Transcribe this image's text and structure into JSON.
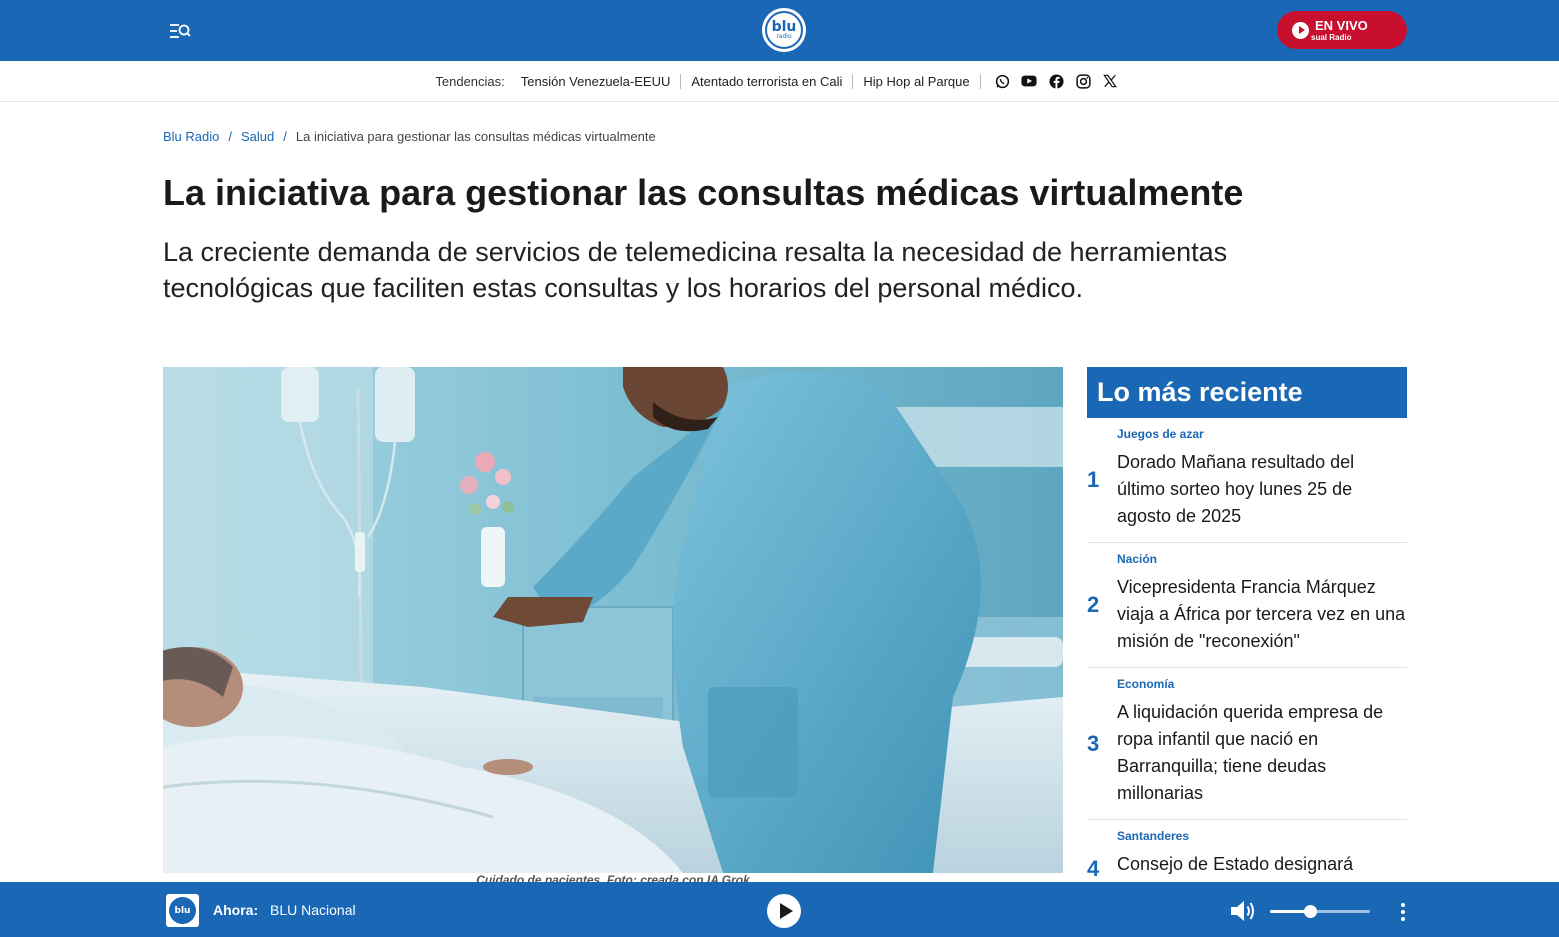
{
  "header": {
    "logo_text": "blu",
    "logo_sub": "radio",
    "live_label": "EN VIVO",
    "live_sub": "sual Radio"
  },
  "trends": {
    "label": "Tendencias:",
    "items": [
      "Tensión Venezuela-EEUU",
      "Atentado terrorista en Cali",
      "Hip Hop al Parque"
    ],
    "social_icons": [
      "whatsapp-icon",
      "youtube-icon",
      "facebook-icon",
      "instagram-icon",
      "x-icon"
    ]
  },
  "breadcrumb": {
    "items": [
      "Blu Radio",
      "Salud"
    ],
    "separator": "/",
    "current": "La iniciativa para gestionar las consultas médicas virtualmente"
  },
  "article": {
    "title": "La iniciativa para gestionar las consultas médicas virtualmente",
    "subtitle": "La creciente demanda de servicios de telemedicina resalta la necesidad de herramientas tecnológicas que faciliten estas consultas y los horarios del personal médico.",
    "caption": "Cuidado de pacientes. Foto: creada con IA Grok"
  },
  "sidebar": {
    "title": "Lo más reciente",
    "items": [
      {
        "num": "1",
        "category": "Juegos de azar",
        "headline": "Dorado Mañana resultado del último sorteo hoy lunes 25 de agosto de 2025"
      },
      {
        "num": "2",
        "category": "Nación",
        "headline": "Vicepresidenta Francia Márquez viaja a África por tercera vez en una misión de \"reconexión\""
      },
      {
        "num": "3",
        "category": "Economía",
        "headline": "A liquidación querida empresa de ropa infantil que nació en Barranquilla; tiene deudas millonarias"
      },
      {
        "num": "4",
        "category": "Santanderes",
        "headline": "Consejo de Estado designará conjuez para definir suerte del"
      }
    ]
  },
  "player": {
    "logo_text": "blu",
    "now_label": "Ahora:",
    "station": "BLU Nacional",
    "volume": 0.4
  },
  "colors": {
    "brand_blue": "#1a67b5",
    "live_red": "#c8102e"
  }
}
